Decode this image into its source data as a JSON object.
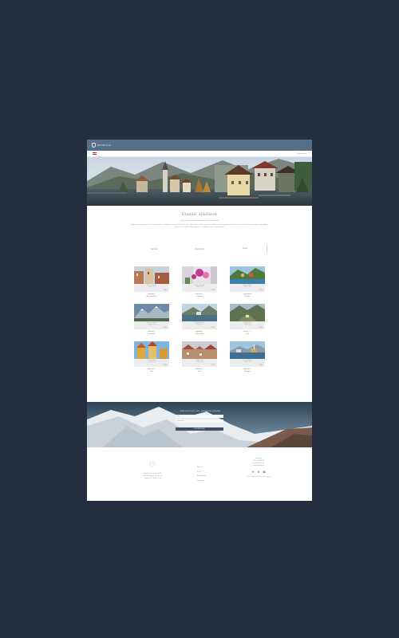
{
  "site": {
    "logo_text": "HOTELVIA"
  },
  "subbar": {
    "language": "HU",
    "account": "Bejelentkezés"
  },
  "main": {
    "title": "Utazási ajánlatok",
    "lead": "Fedezze fel Ausztria legszebb tájait és városait velünk",
    "intro": "Válogasson legkedveltebb úti céljaink közül, és foglalja le következő utazását most. Kényelmes szállás, gondosan megtervezett programok és kedvező árak várják Önt egész évben, hegyvidéken, tóparton és nagyvárosban egyaránt, személyre szabott ajánlatainkkal."
  },
  "tabs": [
    {
      "label": "Városok"
    },
    {
      "label": "Hegyvidék"
    },
    {
      "label": "Tavak"
    }
  ],
  "cards": [
    {
      "line1": "Bécs belvárosa",
      "line2": "3 nap / 2 éj",
      "price": "€ 189",
      "rating": "★★★★☆",
      "name": "Bécs, Ausztria",
      "scene": "city"
    },
    {
      "line1": "Virágos udvarok",
      "line2": "4 nap / 3 éj",
      "price": "€ 249",
      "rating": "★★★★☆",
      "name": "Salzburg",
      "scene": "flowers"
    },
    {
      "line1": "Alpesi kilátás",
      "line2": "5 nap / 4 éj",
      "price": "€ 329",
      "rating": "★★★★★",
      "name": "Hallstatt",
      "scene": "coast"
    },
    {
      "line1": "Havas csúcsok",
      "line2": "3 nap / 2 éj",
      "price": "€ 199",
      "rating": "★★★★☆",
      "name": "Innsbruck",
      "scene": "mountain"
    },
    {
      "line1": "Tóparti pihenés",
      "line2": "4 nap / 3 éj",
      "price": "€ 279",
      "rating": "★★★★☆",
      "name": "Zell am See",
      "scene": "lake"
    },
    {
      "line1": "Völgyi túrák",
      "line2": "6 nap / 5 éj",
      "price": "€ 359",
      "rating": "★★★☆☆",
      "name": "Tirol",
      "scene": "valley"
    },
    {
      "line1": "Őszi fesztivál",
      "line2": "2 nap / 1 éj",
      "price": "€ 129",
      "rating": "★★★★☆",
      "name": "Graz",
      "scene": "festival"
    },
    {
      "line1": "Óváros séta",
      "line2": "3 nap / 2 éj",
      "price": "€ 169",
      "rating": "★★★★☆",
      "name": "Linz",
      "scene": "roofs"
    },
    {
      "line1": "Tavaszi kikötő",
      "line2": "4 nap / 3 éj",
      "price": "€ 239",
      "rating": "★★★★☆",
      "name": "Bregenz",
      "scene": "harbor"
    }
  ],
  "newsletter": {
    "title": "IRATKOZZON FEL HÍRLEVELÜNKRE",
    "name_placeholder": "Név",
    "email_placeholder": "E-mail cím",
    "consent": "Elfogadom az adatkezelési feltételeket",
    "button": "FELIRATKOZÁS"
  },
  "footer": {
    "address1": "Hotelvia Utazási Iroda Kft.",
    "address2": "1051 Budapest, Fő utca 12.",
    "address3": "Nyitva: H–P 9:00–17:00",
    "links": [
      "Rólunk",
      "ÁSZF",
      "Adatvédelem",
      "Kapcsolat"
    ],
    "contact_title": "Kapcsolat",
    "phone": "+36 1 234 5678",
    "email": "info@hotelvia.hu",
    "web": "www.hotelvia.hu",
    "social": [
      "f",
      "t",
      "G"
    ],
    "copyright": "© 2019 Hotelvia. Minden jog fenntartva."
  },
  "colors": {
    "topbar": "#56708a",
    "background": "#252e40",
    "footer_icons": "#2d3b4e"
  }
}
